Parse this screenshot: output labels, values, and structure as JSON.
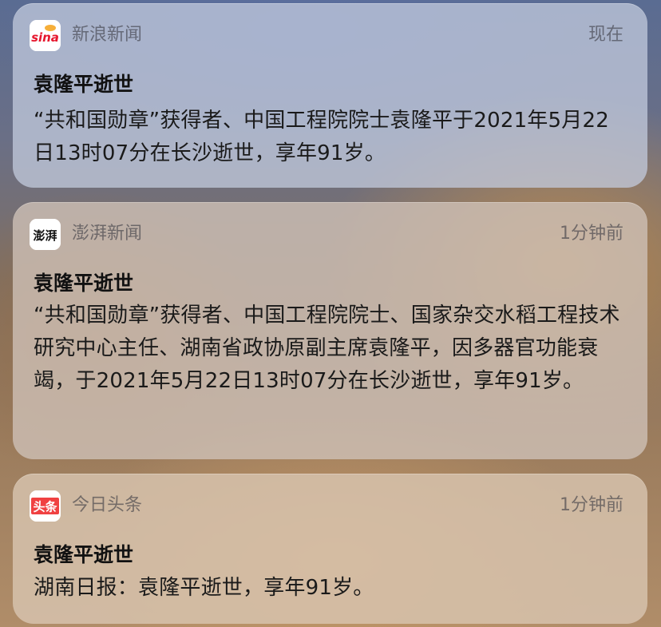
{
  "notifications": [
    {
      "app": "新浪新闻",
      "icon": "sina-news-app-icon",
      "icon_text": "sina",
      "time": "现在",
      "title": "袁隆平逝世",
      "body": "“共和国勋章”获得者、中国工程院院士袁隆平于2021年5月22日13时07分在长沙逝世，享年91岁。"
    },
    {
      "app": "澎湃新闻",
      "icon": "the-paper-app-icon",
      "icon_text": "澎湃",
      "time": "1分钟前",
      "title": "袁隆平逝世",
      "body": "“共和国勋章”获得者、中国工程院院士、国家杂交水稻工程技术研究中心主任、湖南省政协原副主席袁隆平，因多器官功能衰竭，于2021年5月22日13时07分在长沙逝世，享年91岁。"
    },
    {
      "app": "今日头条",
      "icon": "toutiao-app-icon",
      "icon_text": "头条",
      "time": "1分钟前",
      "title": "袁隆平逝世",
      "body": "湖南日报：袁隆平逝世，享年91岁。"
    }
  ],
  "colors": {
    "sina_red": "#e6162d",
    "toutiao_red": "#f04142",
    "secondary_text": "#6e6e73"
  }
}
